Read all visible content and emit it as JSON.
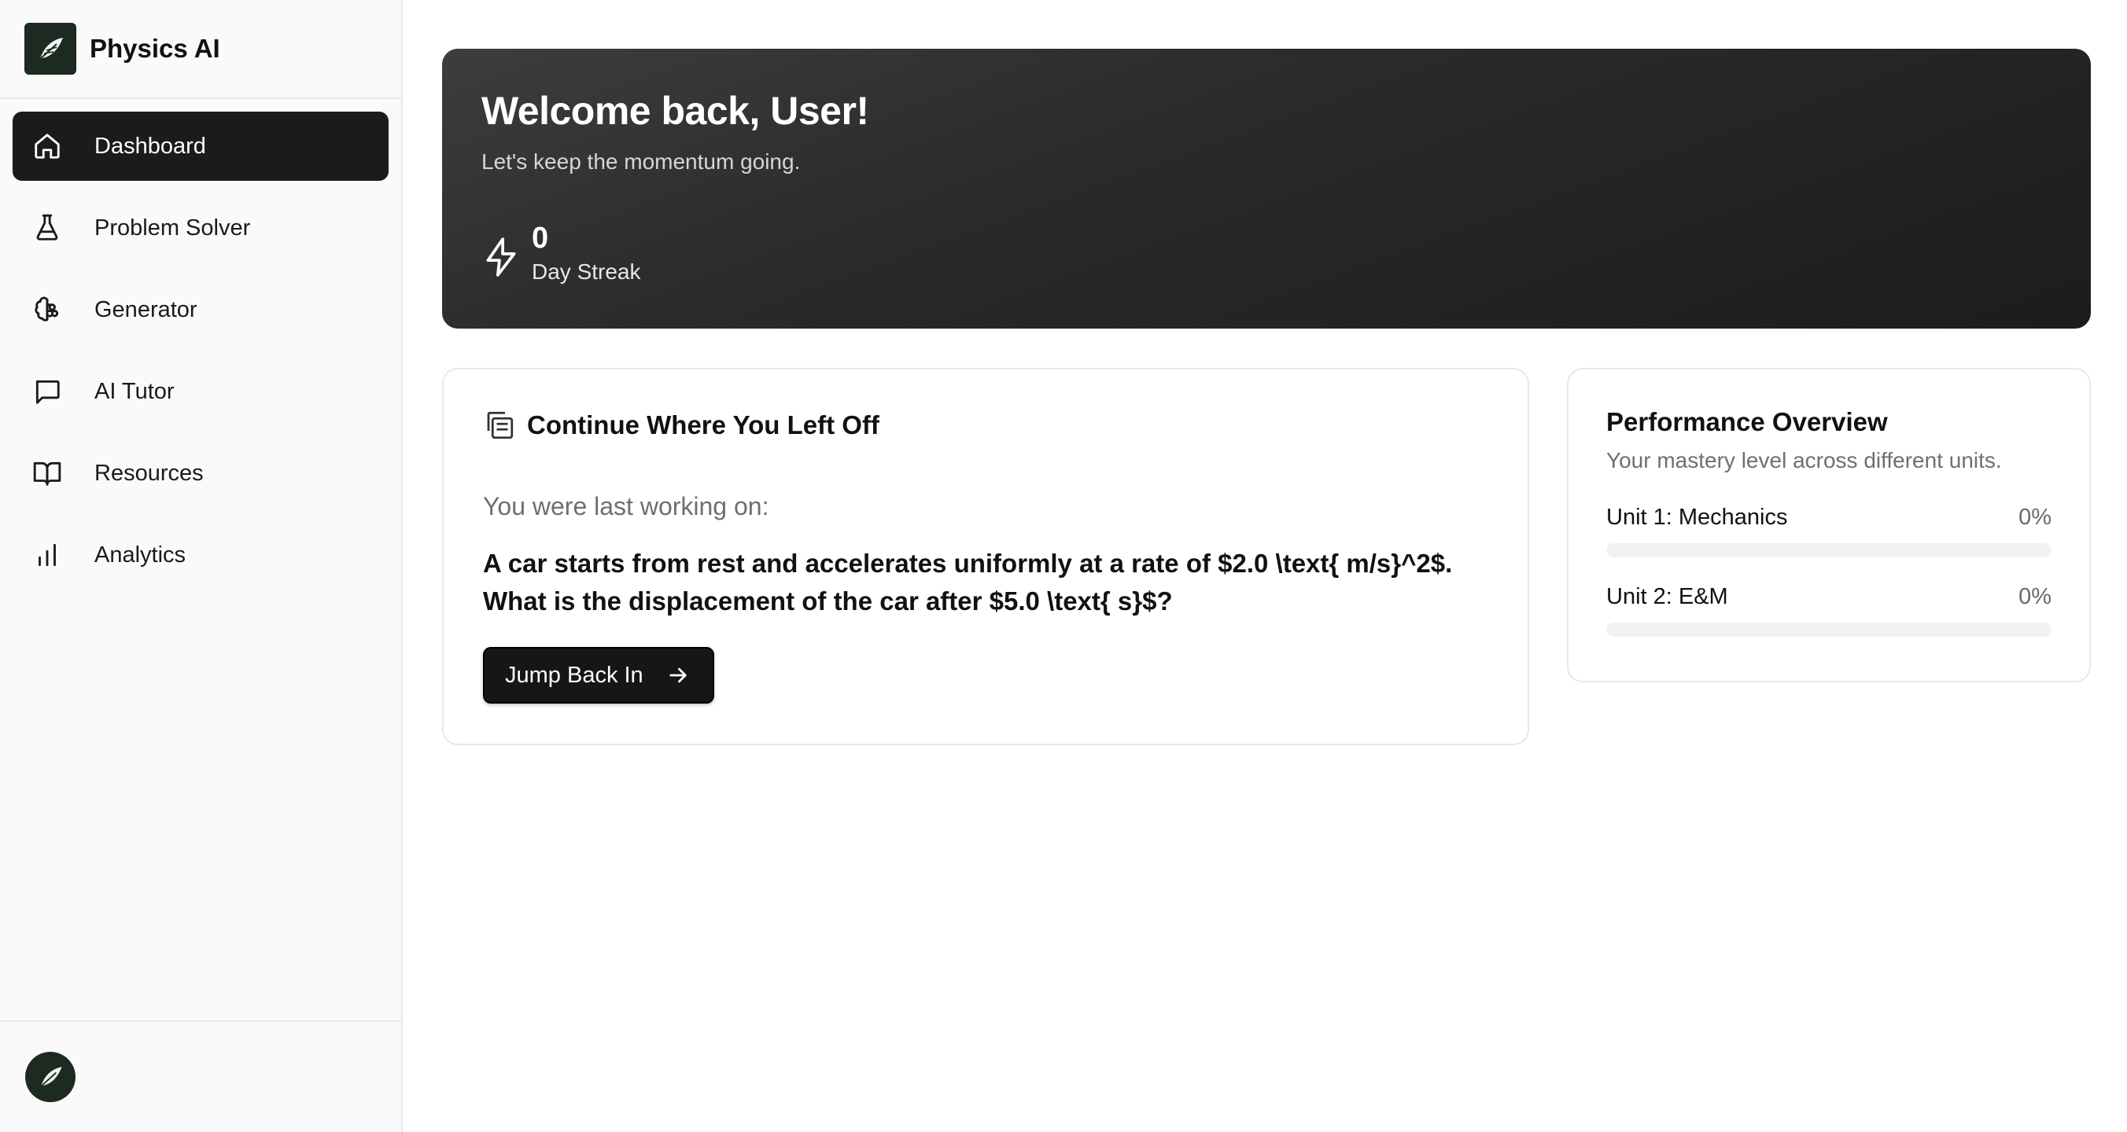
{
  "app": {
    "name": "Physics AI",
    "logo_icon": "feather-logo-icon"
  },
  "sidebar": {
    "items": [
      {
        "label": "Dashboard",
        "icon": "home-icon",
        "active": true
      },
      {
        "label": "Problem Solver",
        "icon": "flask-icon",
        "active": false
      },
      {
        "label": "Generator",
        "icon": "brain-icon",
        "active": false
      },
      {
        "label": "AI Tutor",
        "icon": "chat-icon",
        "active": false
      },
      {
        "label": "Resources",
        "icon": "book-open-icon",
        "active": false
      },
      {
        "label": "Analytics",
        "icon": "bar-chart-icon",
        "active": false
      }
    ]
  },
  "hero": {
    "title": "Welcome back, User!",
    "subtitle": "Let's keep the momentum going.",
    "streak_count": "0",
    "streak_label": "Day Streak"
  },
  "continue": {
    "title": "Continue Where You Left Off",
    "last_label": "You were last working on:",
    "problem": "A car starts from rest and accelerates uniformly at a rate of $2.0 \\text{ m/s}^2$. What is the displacement of the car after $5.0 \\text{ s}$?",
    "button_label": "Jump Back In"
  },
  "performance": {
    "title": "Performance Overview",
    "subtitle": "Your mastery level across different units.",
    "units": [
      {
        "name": "Unit 1: Mechanics",
        "percent_label": "0%",
        "progress": 0
      },
      {
        "name": "Unit 2: E&M",
        "percent_label": "0%",
        "progress": 0
      }
    ]
  },
  "colors": {
    "accent_dark": "#1b1b1b",
    "logo_bg": "#1c2a22",
    "muted_text": "#6f6f6f"
  }
}
